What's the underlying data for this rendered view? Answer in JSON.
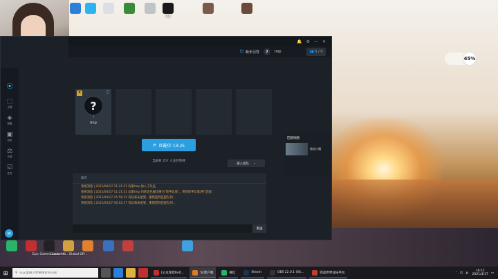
{
  "desktop": {
    "top_icons": [
      {
        "label": "",
        "color": "#2a7fd8"
      },
      {
        "label": "",
        "color": "#2ab4f0"
      },
      {
        "label": "",
        "color": "#dcdfe3"
      },
      {
        "label": "",
        "color": "#3a8a3a"
      },
      {
        "label": "",
        "color": "#c0c4c8"
      },
      {
        "label": "EDI",
        "color": "#1a1a1a"
      },
      {
        "label": "",
        "color": "#7a5a4a"
      },
      {
        "label": "",
        "color": "#6a4a3a"
      }
    ],
    "bottom_icons": [
      {
        "label": "",
        "color": "#2ab46a"
      },
      {
        "label": "",
        "color": "#c03030"
      },
      {
        "label": "Epic Games Launcher",
        "color": "#222"
      },
      {
        "label": "Counter-S... Global Off...",
        "color": "#d1a040"
      },
      {
        "label": "",
        "color": "#e08030"
      },
      {
        "label": "",
        "color": "#3a70c0"
      },
      {
        "label": "",
        "color": "#c04040"
      },
      {
        "label": "",
        "color": "#40a0e0"
      }
    ]
  },
  "widget": {
    "line1": "",
    "line2": "",
    "battery_pct": "45%"
  },
  "app": {
    "crumb": "",
    "nav": {
      "newbie_label": "新手引导",
      "help": "?",
      "username": "Imp",
      "party_count": "0 / 0"
    },
    "rail": [
      {
        "icon": "⦿",
        "label": "",
        "active": true
      },
      {
        "icon": "⬚",
        "label": "主题",
        "active": false
      },
      {
        "icon": "◈",
        "label": "装备",
        "active": false
      },
      {
        "icon": "▣",
        "label": "战队",
        "active": false
      },
      {
        "icon": "⚖",
        "label": "天梯",
        "active": false
      },
      {
        "icon": "☑",
        "label": "任务",
        "active": false
      }
    ],
    "player_slot": {
      "badge": "★",
      "avatar_glyph": "?",
      "rank": "?",
      "name": "Imp"
    },
    "match_button": {
      "label": "匹配中 13:25"
    },
    "queue_text": "当前有 257 人正在等待",
    "invite_button": {
      "label": "邀入组队",
      "chevron": "⌄"
    },
    "side_panel": {
      "title": "匹配地图",
      "map_name": "炼狱小镇"
    },
    "chat": {
      "header": "聊天",
      "lines": [
        "系统消息 | 2021/04/17-11:21:51 玩家Imp 加入了队伍",
        "系统消息 | 2021/04/17-11:21:51 玩家Imp 的状态已被切换为\"新手玩家\"，将同新手玩家进行匹配",
        "系统消息 | 2021/04/17-15:56:12 有玩家未接受，重新回到匹配队列...",
        "系统消息 | 2021/04/17-16:02:17 有玩家未接受，重新回到匹配队列..."
      ],
      "send_label": "发送"
    }
  },
  "taskbar": {
    "search_placeholder": "在这里输入你要搜索的内容",
    "apps": [
      {
        "label": "[公主连结ReD...",
        "color": "#c03030",
        "active": false
      },
      {
        "label": "5E客户端",
        "color": "#e07a20",
        "active": true
      },
      {
        "label": "微信",
        "color": "#2ab46a",
        "active": false
      },
      {
        "label": "Steam",
        "color": "#1b3550",
        "active": false
      },
      {
        "label": "OBS 22.0.1 (64...",
        "color": "#333",
        "active": false
      },
      {
        "label": "完美世界竞技平台",
        "color": "#c04030",
        "active": false
      }
    ],
    "time": "16:12",
    "date": "2021/4/17"
  }
}
